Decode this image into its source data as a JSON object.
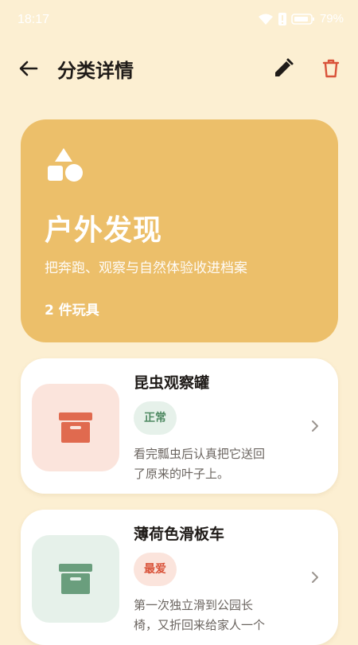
{
  "status_bar": {
    "time": "18:17",
    "battery_percent": "79%",
    "icons": [
      "wifi-icon",
      "alert-icon",
      "battery-icon"
    ]
  },
  "app_bar": {
    "title": "分类详情",
    "icons": {
      "back": "arrow-left-icon",
      "edit": "pencil-icon",
      "delete": "trash-icon"
    }
  },
  "category": {
    "icon": "shapes-icon",
    "name": "户外发现",
    "description": "把奔跑、观察与自然体验收进档案",
    "count": "2 件玩具",
    "color": "#ecbf6a"
  },
  "toys": [
    {
      "name": "昆虫观察罐",
      "status": "正常",
      "note_lines": [
        "看完瓢虫后认真把它送回",
        "了原来的叶子上。"
      ],
      "icon": "box-icon",
      "thumb_bg": "#fbe4dc",
      "icon_color": "#e06a4f",
      "badge_bg": "#e6f1ea",
      "badge_color": "#4f8a63"
    },
    {
      "name": "薄荷色滑板车",
      "status": "最爱",
      "note_lines": [
        "第一次独立滑到公园长",
        "椅，又折回来给家人一个"
      ],
      "icon": "box-icon",
      "thumb_bg": "#e6f1ea",
      "icon_color": "#6a9e7d",
      "badge_bg": "#fbe4dc",
      "badge_color": "#d9533a"
    }
  ]
}
